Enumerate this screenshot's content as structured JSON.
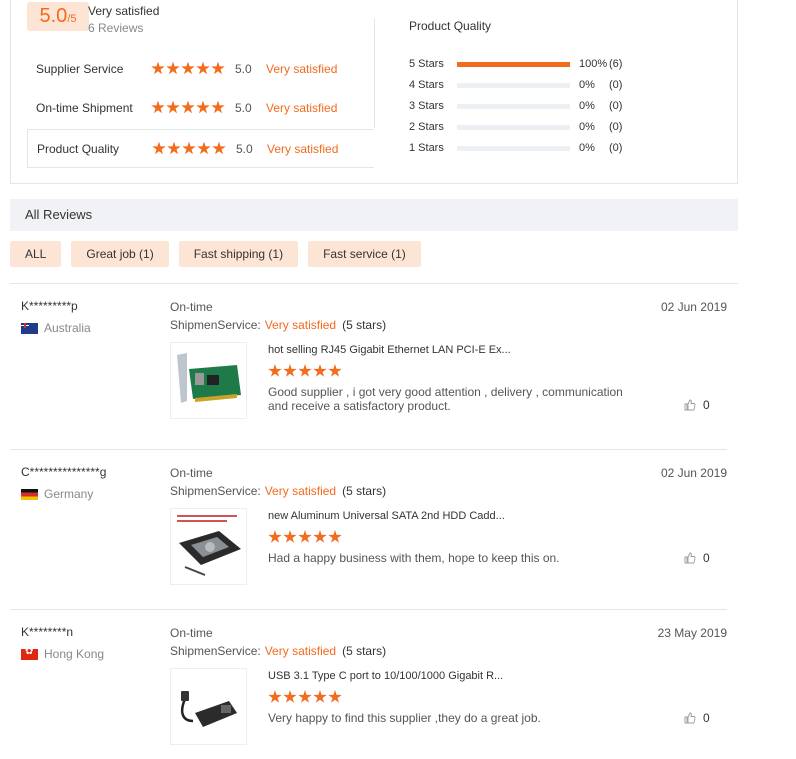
{
  "summary": {
    "score": "5.0",
    "score_max": "/5",
    "overall_label": "Very satisfied",
    "review_count": "6 Reviews",
    "ratings": [
      {
        "label": "Supplier Service",
        "score": "5.0",
        "text": "Very satisfied"
      },
      {
        "label": "On-time Shipment",
        "score": "5.0",
        "text": "Very satisfied"
      },
      {
        "label": "Product Quality",
        "score": "5.0",
        "text": "Very satisfied"
      }
    ],
    "distribution_title": "Product Quality",
    "distribution": [
      {
        "label": "5 Stars",
        "pct": "100%",
        "count": "(6)",
        "fraction": 1.0
      },
      {
        "label": "4 Stars",
        "pct": "0%",
        "count": "(0)",
        "fraction": 0
      },
      {
        "label": "3 Stars",
        "pct": "0%",
        "count": "(0)",
        "fraction": 0
      },
      {
        "label": "2 Stars",
        "pct": "0%",
        "count": "(0)",
        "fraction": 0
      },
      {
        "label": "1 Stars",
        "pct": "0%",
        "count": "(0)",
        "fraction": 0
      }
    ]
  },
  "all_reviews": {
    "title": "All Reviews",
    "filters": [
      "ALL",
      "Great job (1)",
      "Fast shipping (1)",
      "Fast service (1)"
    ]
  },
  "reviews": [
    {
      "name": "K*********p",
      "country": "Australia",
      "flag": "au",
      "shipment_label": "On-time",
      "line2_overlap": "ShipmenService:",
      "satisfaction": "Very satisfied",
      "stars_text": "(5 stars)",
      "date": "02 Jun 2019",
      "product_title": "hot selling RJ45 Gigabit Ethernet LAN PCI-E Ex...",
      "text": "Good supplier , i got very good attention , delivery , communication and receive a satisfactory product.",
      "likes": "0"
    },
    {
      "name": "C***************g",
      "country": "Germany",
      "flag": "de",
      "shipment_label": "On-time",
      "line2_overlap": "ShipmenService:",
      "satisfaction": "Very satisfied",
      "stars_text": "(5 stars)",
      "date": "02 Jun 2019",
      "product_title": "new Aluminum Universal SATA 2nd HDD Cadd...",
      "text": "Had a happy business with them, hope to keep this on.",
      "likes": "0"
    },
    {
      "name": "K********n",
      "country": "Hong Kong",
      "flag": "hk",
      "shipment_label": "On-time",
      "line2_overlap": "ShipmenService:",
      "satisfaction": "Very satisfied",
      "stars_text": "(5 stars)",
      "date": "23 May 2019",
      "product_title": "USB 3.1 Type C port to 10/100/1000 Gigabit R...",
      "text": "Very happy to find this supplier ,they do a great job.",
      "likes": "0"
    }
  ]
}
